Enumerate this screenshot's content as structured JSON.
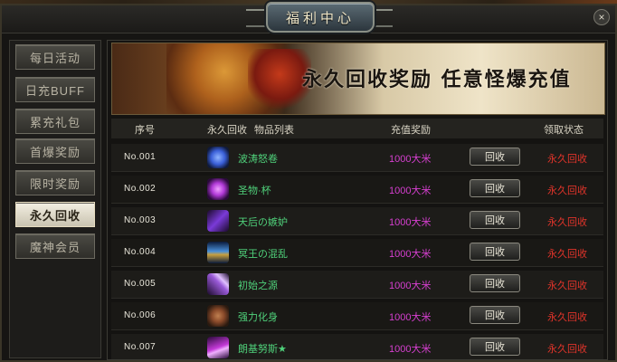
{
  "window": {
    "title": "福利中心",
    "close_label": "×"
  },
  "sidebar": {
    "items": [
      {
        "label": "每日活动"
      },
      {
        "label": "日充BUFF"
      },
      {
        "label": "累充礼包"
      },
      {
        "label": "首爆奖励"
      },
      {
        "label": "限时奖励"
      },
      {
        "label": "永久回收",
        "active": true
      },
      {
        "label": "魔神会员"
      }
    ]
  },
  "banner": {
    "text": "永久回收奖励  任意怪爆充值"
  },
  "table": {
    "headers": {
      "no": "序号",
      "recycle": "永久回收",
      "items": "物品列表",
      "reward": "充值奖励",
      "status": "领取状态"
    },
    "rows": [
      {
        "no": "No.001",
        "name": "波涛怒卷",
        "reward": "1000大米",
        "button": "回收",
        "status": "永久回收",
        "icon": "blue-crystal-icon",
        "icon_color": "#3a5fd8"
      },
      {
        "no": "No.002",
        "name": "圣物·杯",
        "reward": "1000大米",
        "button": "回收",
        "status": "永久回收",
        "icon": "purple-orb-icon",
        "icon_color": "#b23ad8"
      },
      {
        "no": "No.003",
        "name": "天后の嫉妒",
        "reward": "1000大米",
        "button": "回收",
        "status": "永久回收",
        "icon": "violet-blades-icon",
        "icon_color": "#7a3ad8"
      },
      {
        "no": "No.004",
        "name": "冥王の混乱",
        "reward": "1000大米",
        "button": "回收",
        "status": "永久回收",
        "icon": "crown-icon",
        "icon_color": "#4a8fd8"
      },
      {
        "no": "No.005",
        "name": "初始之源",
        "reward": "1000大米",
        "button": "回收",
        "status": "永久回收",
        "icon": "feather-icon",
        "icon_color": "#9a5ad8"
      },
      {
        "no": "No.006",
        "name": "强力化身",
        "reward": "1000大米",
        "button": "回收",
        "status": "永久回收",
        "icon": "dark-armor-icon",
        "icon_color": "#8a4a2a"
      },
      {
        "no": "No.007",
        "name": "朗基努斯★",
        "reward": "1000大米",
        "button": "回收",
        "status": "永久回收",
        "icon": "spear-icon",
        "icon_color": "#c43ad8"
      }
    ]
  }
}
